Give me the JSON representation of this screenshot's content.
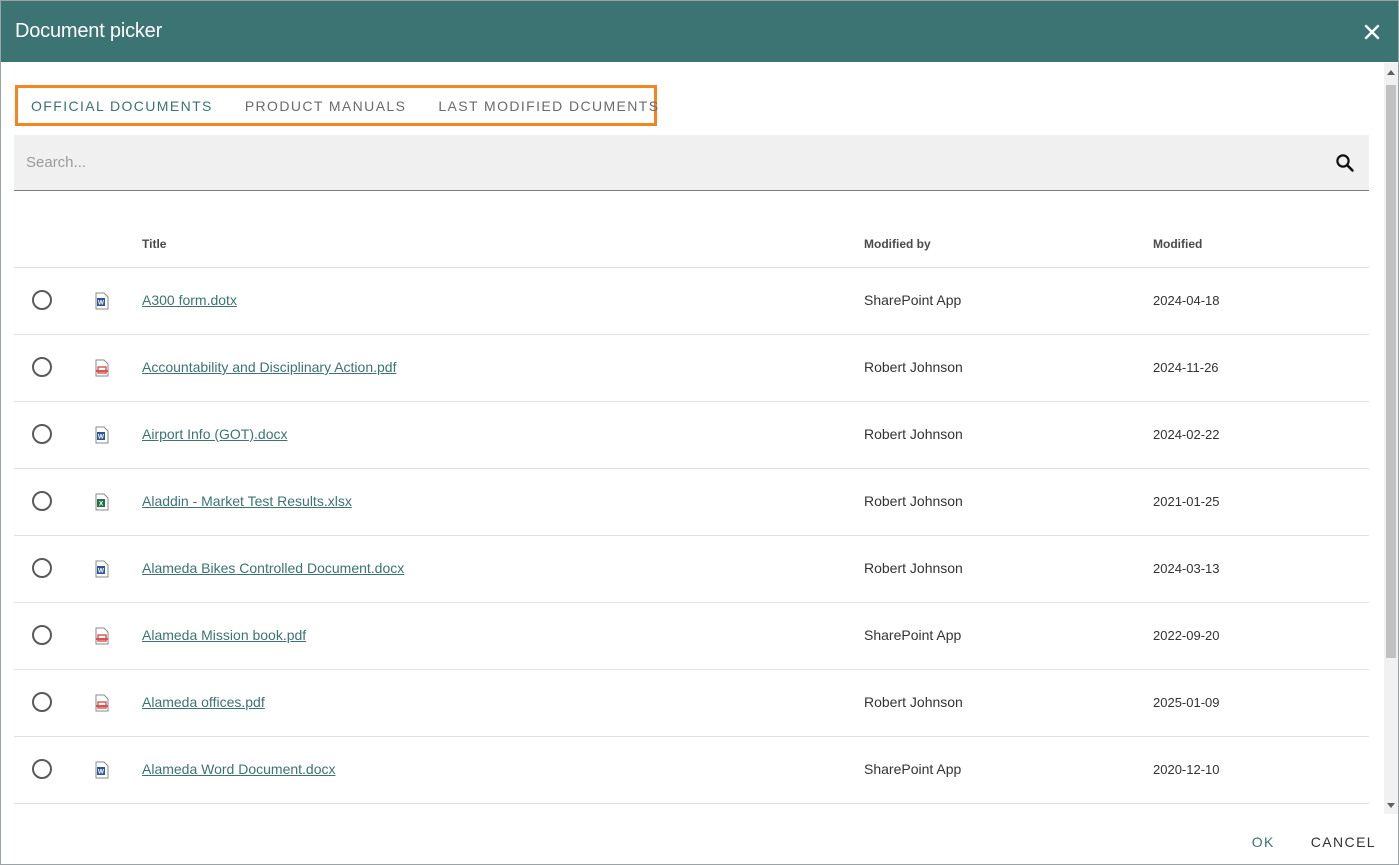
{
  "dialog": {
    "title": "Document picker"
  },
  "tabs": [
    {
      "label": "OFFICIAL DOCUMENTS",
      "active": true
    },
    {
      "label": "PRODUCT MANUALS",
      "active": false
    },
    {
      "label": "LAST MODIFIED DCUMENTS",
      "active": false
    }
  ],
  "search": {
    "placeholder": "Search..."
  },
  "table": {
    "headers": {
      "title": "Title",
      "modified_by": "Modified by",
      "modified": "Modified"
    },
    "rows": [
      {
        "type": "word",
        "title": "A300 form.dotx",
        "modified_by": "SharePoint App",
        "modified": "2024-04-18"
      },
      {
        "type": "pdf",
        "title": "Accountability and Disciplinary Action.pdf",
        "modified_by": "Robert Johnson",
        "modified": "2024-11-26"
      },
      {
        "type": "word",
        "title": "Airport Info (GOT).docx",
        "modified_by": "Robert Johnson",
        "modified": "2024-02-22"
      },
      {
        "type": "excel",
        "title": "Aladdin - Market Test Results.xlsx",
        "modified_by": "Robert Johnson",
        "modified": "2021-01-25"
      },
      {
        "type": "word",
        "title": "Alameda Bikes Controlled Document.docx",
        "modified_by": "Robert Johnson",
        "modified": "2024-03-13"
      },
      {
        "type": "pdf",
        "title": "Alameda Mission book.pdf",
        "modified_by": "SharePoint App",
        "modified": "2022-09-20"
      },
      {
        "type": "pdf",
        "title": "Alameda offices.pdf",
        "modified_by": "Robert Johnson",
        "modified": "2025-01-09"
      },
      {
        "type": "word",
        "title": "Alameda Word Document.docx",
        "modified_by": "SharePoint App",
        "modified": "2020-12-10"
      }
    ]
  },
  "footer": {
    "ok_label": "OK",
    "cancel_label": "CANCEL"
  },
  "colors": {
    "header": "#3c7373",
    "highlight": "#f5841f",
    "word": "#2b579a",
    "pdf": "#d9534f",
    "excel": "#217346"
  }
}
